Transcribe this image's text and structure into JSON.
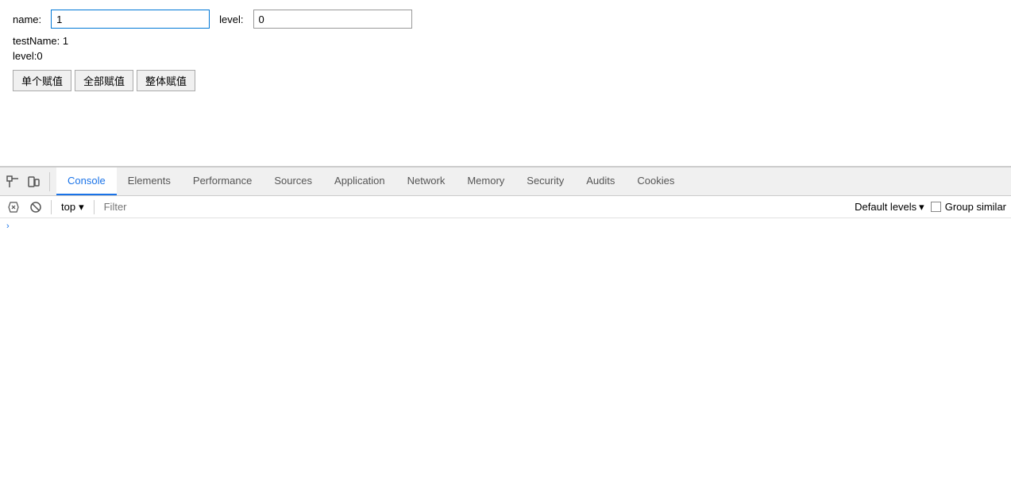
{
  "main": {
    "name_label": "name:",
    "name_value": "1",
    "level_label": "level:",
    "level_value": "0",
    "test_name_text": "testName: 1",
    "level_text": "level:0",
    "buttons": [
      {
        "label": "单个赋值",
        "name": "single-assign-button"
      },
      {
        "label": "全部赋值",
        "name": "all-assign-button"
      },
      {
        "label": "整体赋值",
        "name": "whole-assign-button"
      }
    ]
  },
  "devtools": {
    "tabs": [
      {
        "label": "Console",
        "name": "tab-console",
        "active": true
      },
      {
        "label": "Elements",
        "name": "tab-elements",
        "active": false
      },
      {
        "label": "Performance",
        "name": "tab-performance",
        "active": false
      },
      {
        "label": "Sources",
        "name": "tab-sources",
        "active": false
      },
      {
        "label": "Application",
        "name": "tab-application",
        "active": false
      },
      {
        "label": "Network",
        "name": "tab-network",
        "active": false
      },
      {
        "label": "Memory",
        "name": "tab-memory",
        "active": false
      },
      {
        "label": "Security",
        "name": "tab-security",
        "active": false
      },
      {
        "label": "Audits",
        "name": "tab-audits",
        "active": false
      },
      {
        "label": "Cookies",
        "name": "tab-cookies",
        "active": false
      }
    ],
    "toolbar": {
      "context": "top",
      "context_arrow": "▾",
      "filter_placeholder": "Filter",
      "default_levels": "Default levels",
      "default_levels_arrow": "▾",
      "group_similar": "Group similar"
    }
  }
}
